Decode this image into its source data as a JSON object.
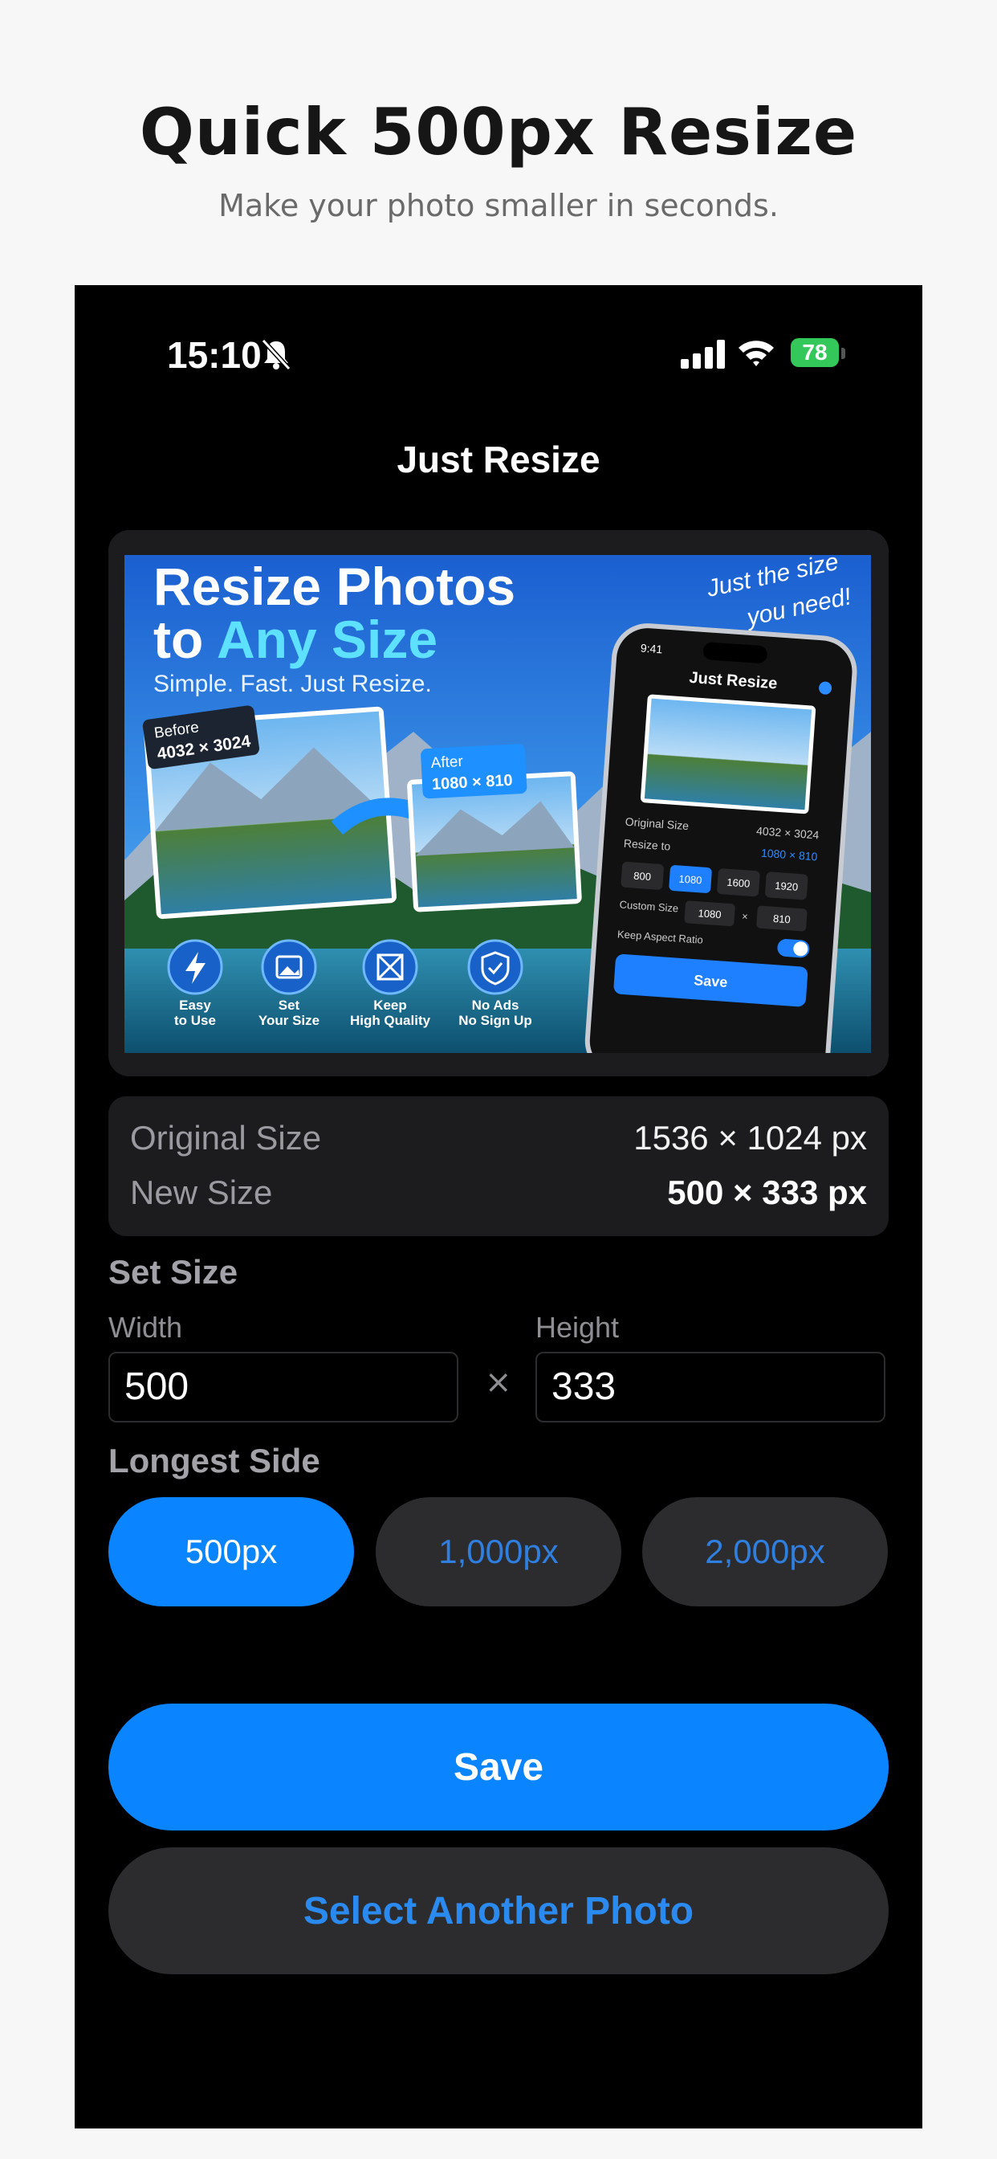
{
  "headline": "Quick 500px Resize",
  "subline": "Make your photo smaller in seconds.",
  "status": {
    "time": "15:10",
    "battery": "78"
  },
  "app": {
    "title": "Just Resize"
  },
  "preview": {
    "title_line1": "Resize Photos",
    "title_line2a": "to ",
    "title_line2b": "Any Size",
    "tagline": "Simple. Fast. Just Resize.",
    "script_line1": "Just the size",
    "script_line2": "you need!",
    "before_label": "Before",
    "before_size": "4032 × 3024",
    "after_label": "After",
    "after_size": "1080 × 810",
    "features": [
      {
        "icon": "lightning-icon",
        "line1": "Easy",
        "line2": "to Use"
      },
      {
        "icon": "image-icon",
        "line1": "Set",
        "line2": "Your Size"
      },
      {
        "icon": "quality-icon",
        "line1": "Keep",
        "line2": "High Quality"
      },
      {
        "icon": "shield-check-icon",
        "line1": "No Ads",
        "line2": "No Sign Up"
      }
    ],
    "mock": {
      "time": "9:41",
      "title": "Just Resize",
      "original_label": "Original Size",
      "original_value": "4032 × 3024",
      "resize_label": "Resize to",
      "resize_value": "1080 × 810",
      "presets": [
        "800",
        "1080",
        "1600",
        "1920"
      ],
      "custom_label": "Custom Size",
      "custom_w": "1080",
      "custom_x": "×",
      "custom_h": "810",
      "aspect_label": "Keep Aspect Ratio",
      "save": "Save"
    }
  },
  "info": {
    "original_label": "Original Size",
    "original_value": "1536 × 1024 px",
    "new_label": "New Size",
    "new_value": "500 × 333 px"
  },
  "set_size": {
    "title": "Set Size",
    "width_label": "Width",
    "height_label": "Height",
    "width_value": "500",
    "height_value": "333",
    "times": "×"
  },
  "longest_side": {
    "title": "Longest Side",
    "options": [
      "500px",
      "1,000px",
      "2,000px"
    ]
  },
  "buttons": {
    "save": "Save",
    "select": "Select Another Photo"
  },
  "colors": {
    "accent": "#0a84ff",
    "battery": "#34c759",
    "background": "#000000"
  }
}
